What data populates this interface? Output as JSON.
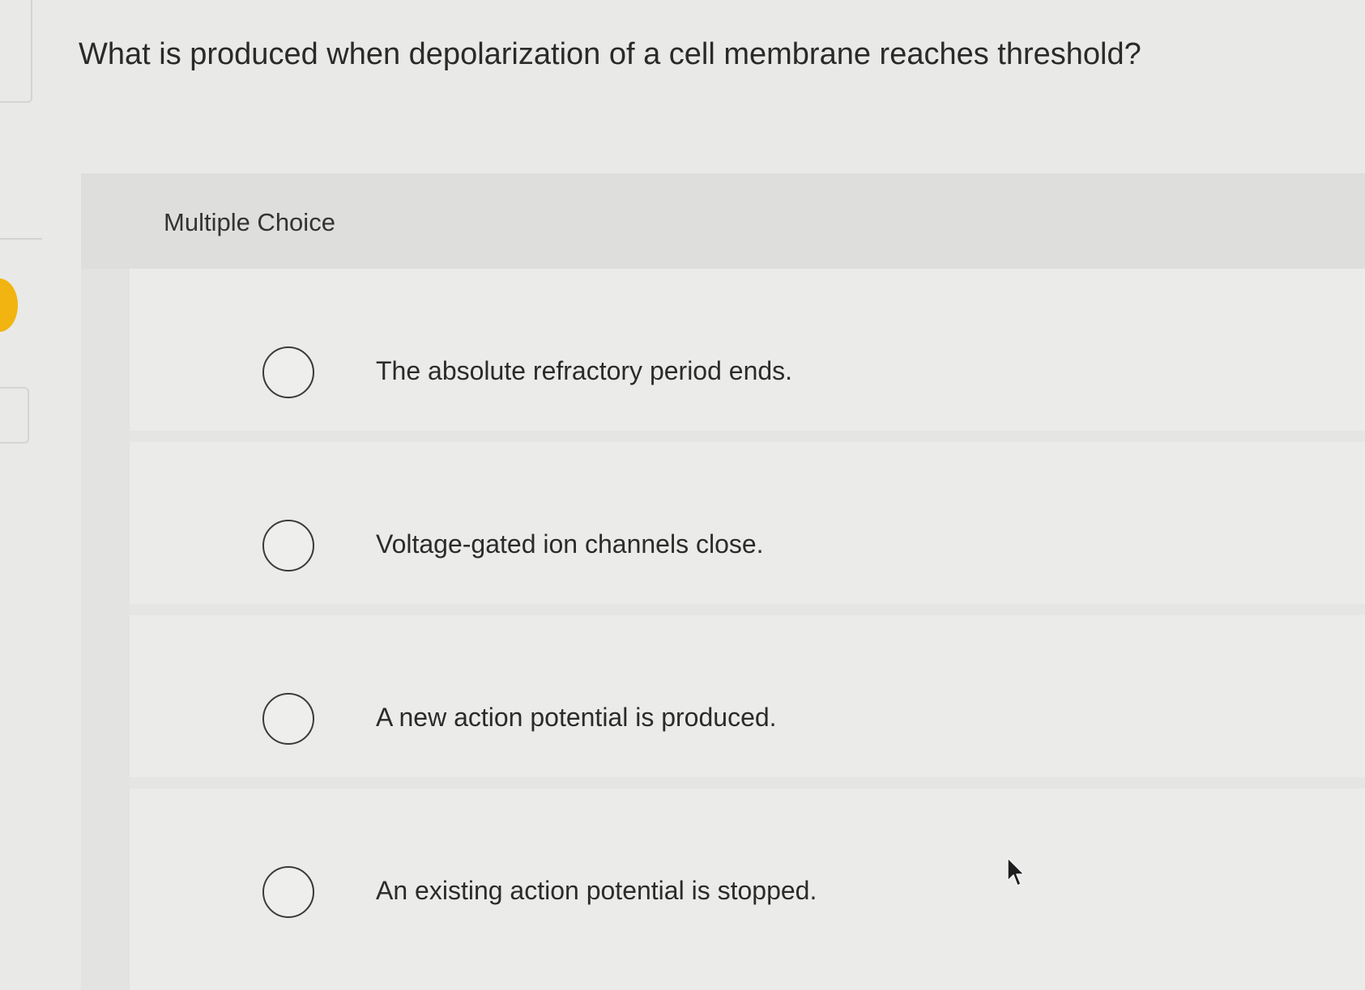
{
  "question": {
    "text": "What is produced when depolarization of a cell membrane reaches threshold?"
  },
  "panel": {
    "type_label": "Multiple Choice"
  },
  "options": [
    {
      "text": "The absolute refractory period ends.",
      "selected": false
    },
    {
      "text": "Voltage-gated ion channels close.",
      "selected": false
    },
    {
      "text": "A new action potential is produced.",
      "selected": false
    },
    {
      "text": "An existing action potential is stopped.",
      "selected": false
    }
  ],
  "colors": {
    "background": "#e9e9e7",
    "text": "#2b2b2b",
    "radio_border": "#3a3a3a",
    "accent_marker": "#f2b410"
  },
  "icons": {
    "cursor": "mouse-pointer-icon",
    "radio": "radio-unchecked-icon"
  }
}
